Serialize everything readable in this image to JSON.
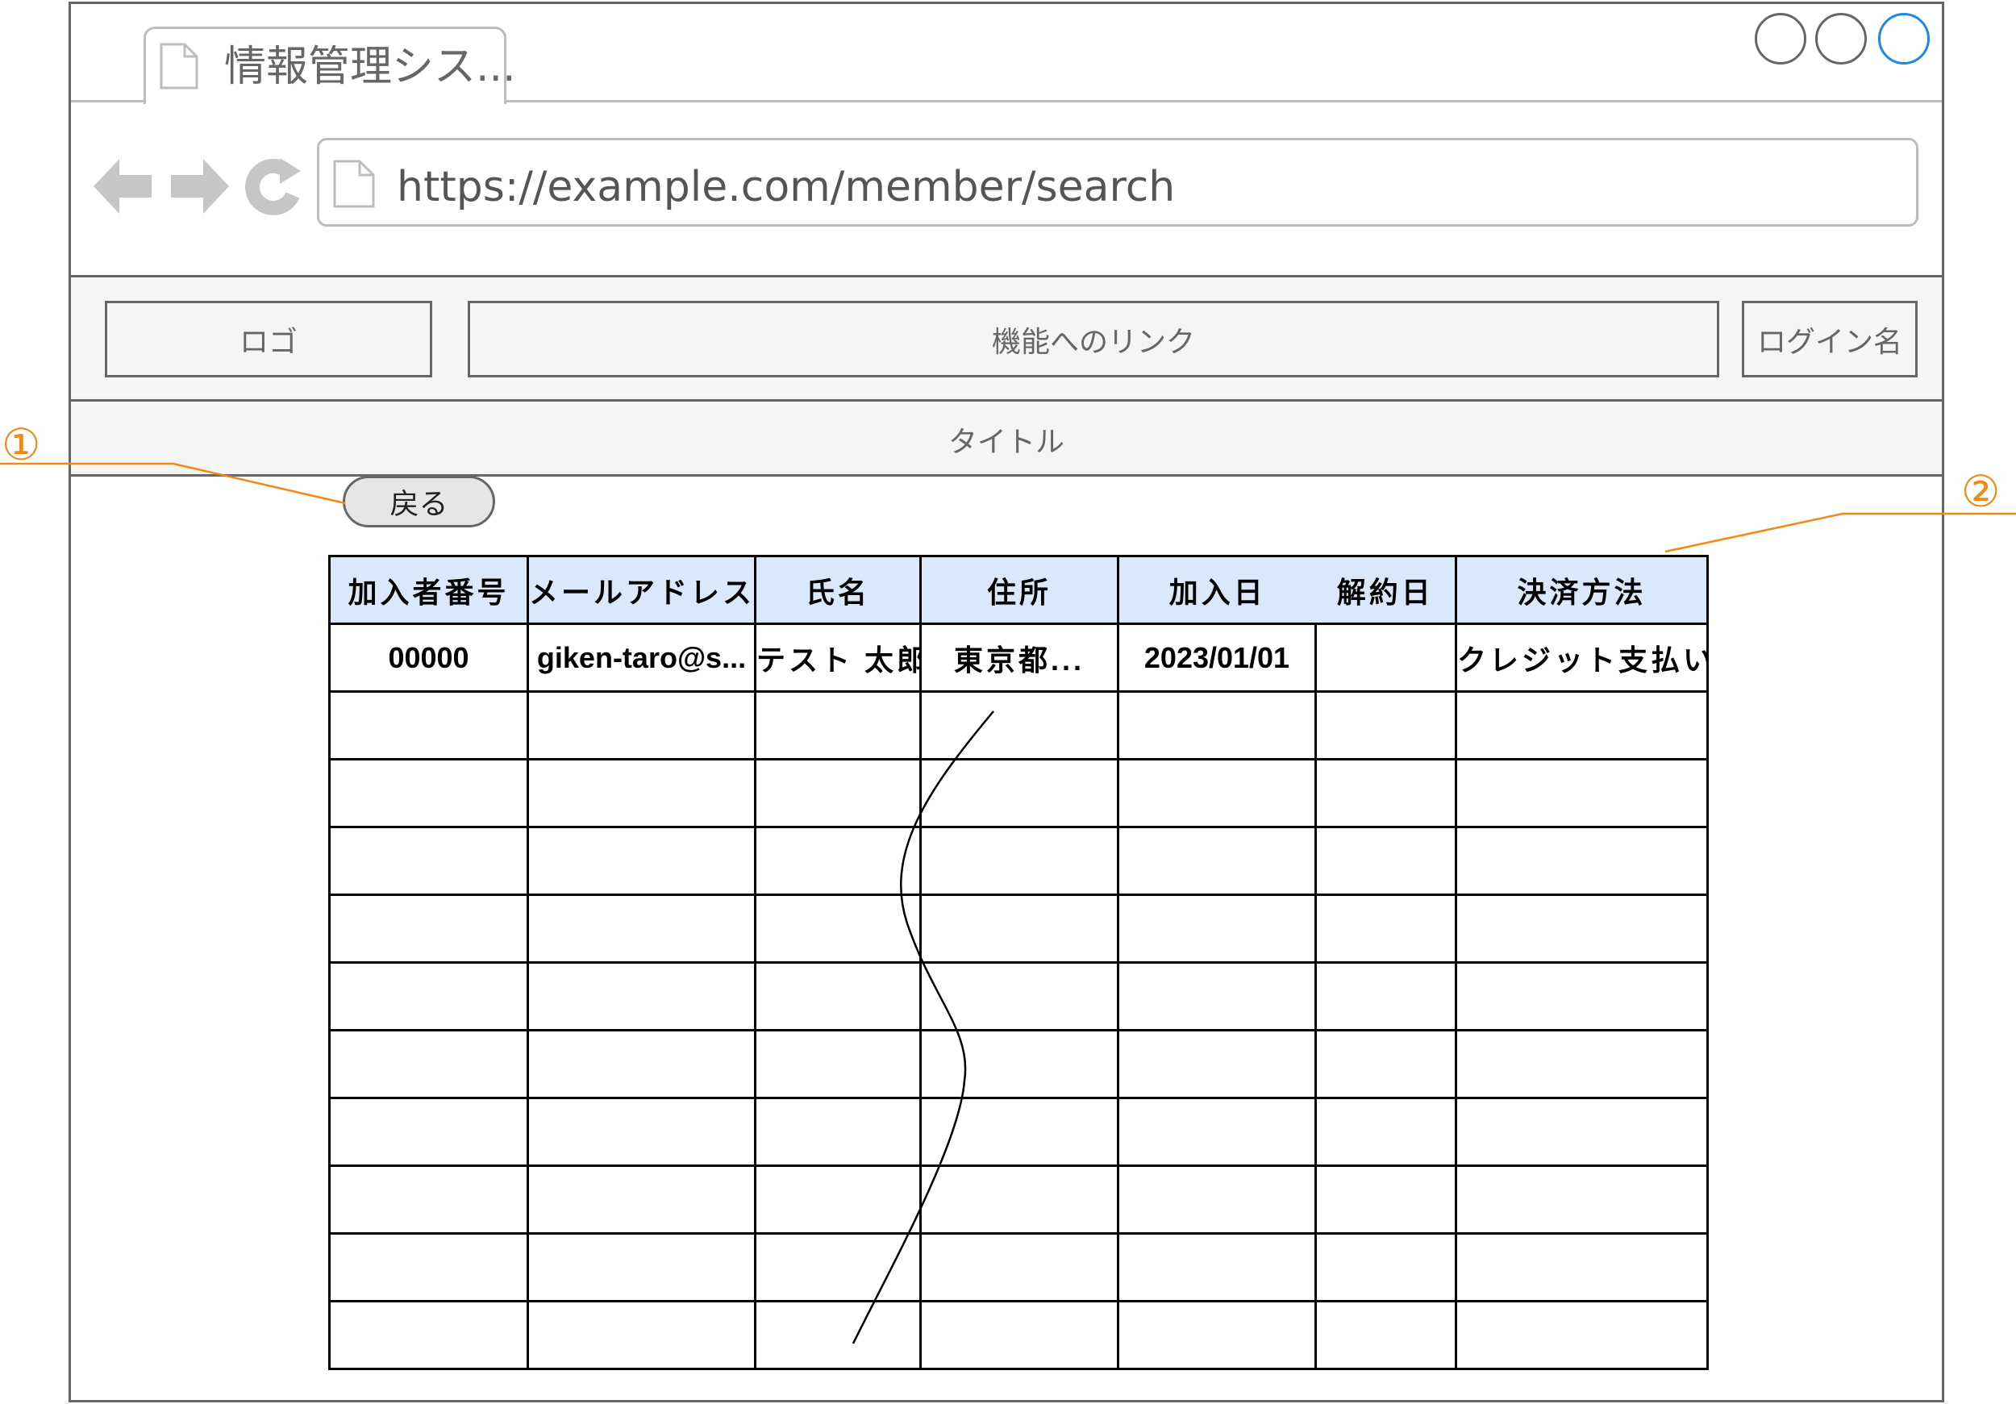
{
  "browser": {
    "tab_title": "情報管理シス...",
    "url": "https://example.com/member/search",
    "window_buttons": [
      "minimize",
      "maximize",
      "close"
    ],
    "close_button_color": "#1e88e5"
  },
  "header": {
    "logo_label": "ロゴ",
    "nav_label": "機能へのリンク",
    "login_label": "ログイン名",
    "title": "タイトル"
  },
  "back_button_label": "戻る",
  "callouts": {
    "one": "①",
    "two": "②",
    "color": "#ef8a17"
  },
  "table": {
    "header_bg": "#dae8fc",
    "columns": [
      "加入者番号",
      "メールアドレス",
      "氏名",
      "住所",
      "加入日",
      "解約日",
      "決済方法"
    ],
    "rows": [
      [
        "00000",
        "giken-taro@s...",
        "テスト 太郎",
        "東京都...",
        "2023/01/01",
        "",
        "クレジット支払い"
      ]
    ],
    "empty_row_count": 10
  }
}
